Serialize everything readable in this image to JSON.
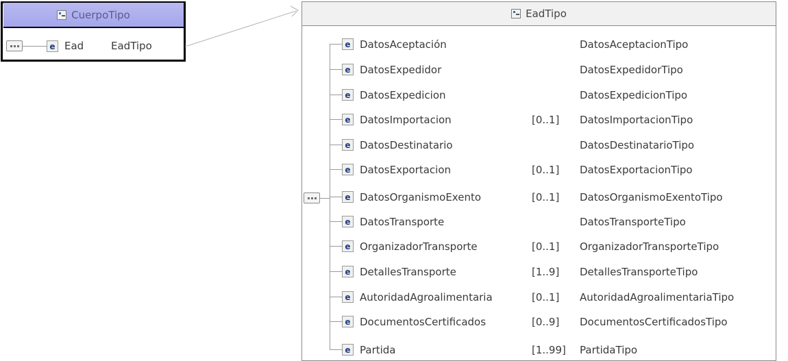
{
  "cuerpo": {
    "title": "CuerpoTipo",
    "element": {
      "name": "Ead",
      "type": "EadTipo"
    }
  },
  "ead": {
    "title": "EadTipo",
    "rows": [
      {
        "name": "DatosAceptación",
        "card": "",
        "type": "DatosAceptacionTipo"
      },
      {
        "name": "DatosExpedidor",
        "card": "",
        "type": "DatosExpedidorTipo"
      },
      {
        "name": "DatosExpedicion",
        "card": "",
        "type": "DatosExpedicionTipo"
      },
      {
        "name": "DatosImportacion",
        "card": "[0..1]",
        "type": "DatosImportacionTipo"
      },
      {
        "name": "DatosDestinatario",
        "card": "",
        "type": "DatosDestinatarioTipo"
      },
      {
        "name": "DatosExportacion",
        "card": "[0..1]",
        "type": "DatosExportacionTipo"
      },
      {
        "name": "DatosOrganismoExento",
        "card": "[0..1]",
        "type": "DatosOrganismoExentoTipo"
      },
      {
        "name": "DatosTransporte",
        "card": "",
        "type": "DatosTransporteTipo"
      },
      {
        "name": "OrganizadorTransporte",
        "card": "[0..1]",
        "type": "OrganizadorTransporteTipo"
      },
      {
        "name": "DetallesTransporte",
        "card": "[1..9]",
        "type": "DetallesTransporteTipo"
      },
      {
        "name": "AutoridadAgroalimentaria",
        "card": "[0..1]",
        "type": "AutoridadAgroalimentariaTipo"
      },
      {
        "name": "DocumentosCertificados",
        "card": "[0..9]",
        "type": "DocumentosCertificadosTipo"
      },
      {
        "name": "Partida",
        "card": "[1..99]",
        "type": "PartidaTipo"
      }
    ]
  }
}
